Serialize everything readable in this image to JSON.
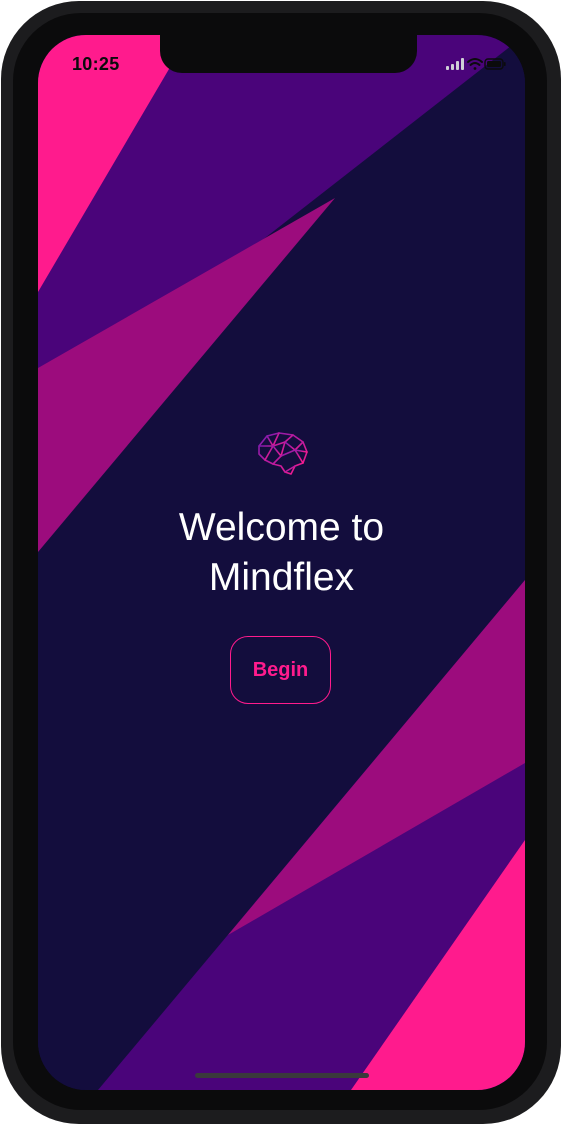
{
  "status_bar": {
    "time": "10:25",
    "icons": [
      "signal-icon",
      "wifi-icon",
      "battery-icon"
    ]
  },
  "welcome": {
    "line1": "Welcome to",
    "line2": "Mindflex"
  },
  "begin_button": {
    "label": "Begin"
  },
  "colors": {
    "background": "#130d3d",
    "stripe_purple": "#4a047a",
    "stripe_magenta": "#9c0c7d",
    "accent_pink": "#ff1b8d",
    "text": "#ffffff"
  },
  "logo_icon": "brain-icon"
}
